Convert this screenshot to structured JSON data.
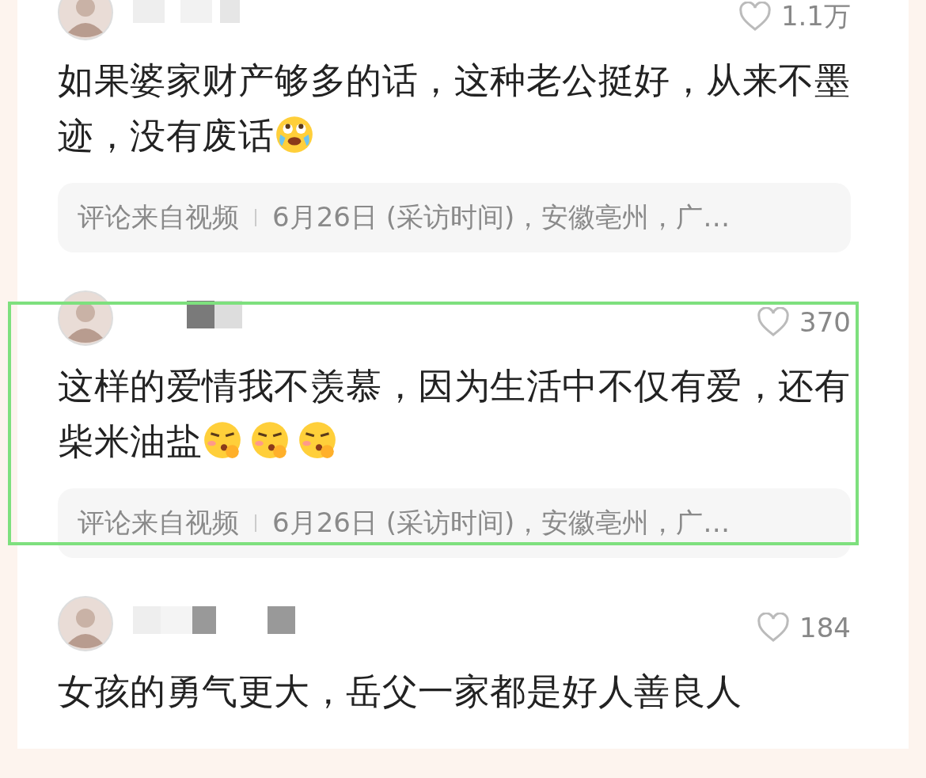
{
  "comments": [
    {
      "likes": "1.1万",
      "text": "如果婆家财产够多的话，这种老公挺好，从来不墨迹，没有废话",
      "emoji": [
        {
          "kind": "crying"
        }
      ],
      "meta": {
        "source": "评论来自视频",
        "detail": "6月26日 (采访时间)，安徽亳州，广…"
      },
      "highlighted": false
    },
    {
      "likes": "370",
      "text": "这样的爱情我不羡慕，因为生活中不仅有爱，还有柴米油盐",
      "emoji": [
        {
          "kind": "shushing"
        },
        {
          "kind": "shushing"
        },
        {
          "kind": "shushing"
        }
      ],
      "meta": {
        "source": "评论来自视频",
        "detail": "6月26日 (采访时间)，安徽亳州，广…"
      },
      "highlighted": true
    },
    {
      "likes": "184",
      "text": "女孩的勇气更大，岳父一家都是好人善良人",
      "highlighted": false
    }
  ]
}
